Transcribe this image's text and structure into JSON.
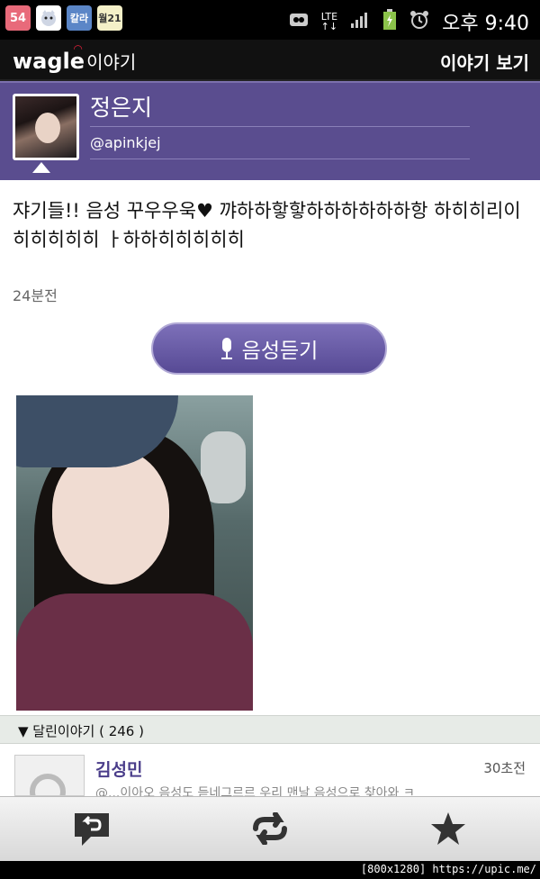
{
  "status_bar": {
    "notification_icons": [
      "54",
      "cat-app-icon",
      "칼라",
      "월21"
    ],
    "network": "LTE",
    "time": "오후 9:40"
  },
  "app_bar": {
    "logo": "wagle",
    "logo_sub": "이야기",
    "title": "이야기 보기"
  },
  "profile": {
    "name": "정은지",
    "handle": "@apinkjej"
  },
  "post": {
    "text": "쟈기들!! 음성 꾸우우욱♥ 꺄하하핳핳하하하하하하항 하히히리이히히히히히 ㅏ하하히히히히히",
    "time_ago": "24분전",
    "voice_button_label": "음성듣기"
  },
  "comments": {
    "header_label": "▼ 달린이야기 ( 246 )",
    "items": [
      {
        "name": "김성민",
        "time_ago": "30초전",
        "preview": "@...이아오 음성도 듣네그르르 우리 맨날 음성으로 찾아와 ㅋ"
      }
    ]
  },
  "bottom_bar": {
    "buttons": [
      "reply-icon",
      "retweet-icon",
      "star-icon"
    ]
  },
  "watermark": "[800x1280] https://upic.me/",
  "colors": {
    "purple": "#5a4d8f",
    "voice_button": "#6a5da8",
    "comment_name": "#4a3d8a"
  }
}
